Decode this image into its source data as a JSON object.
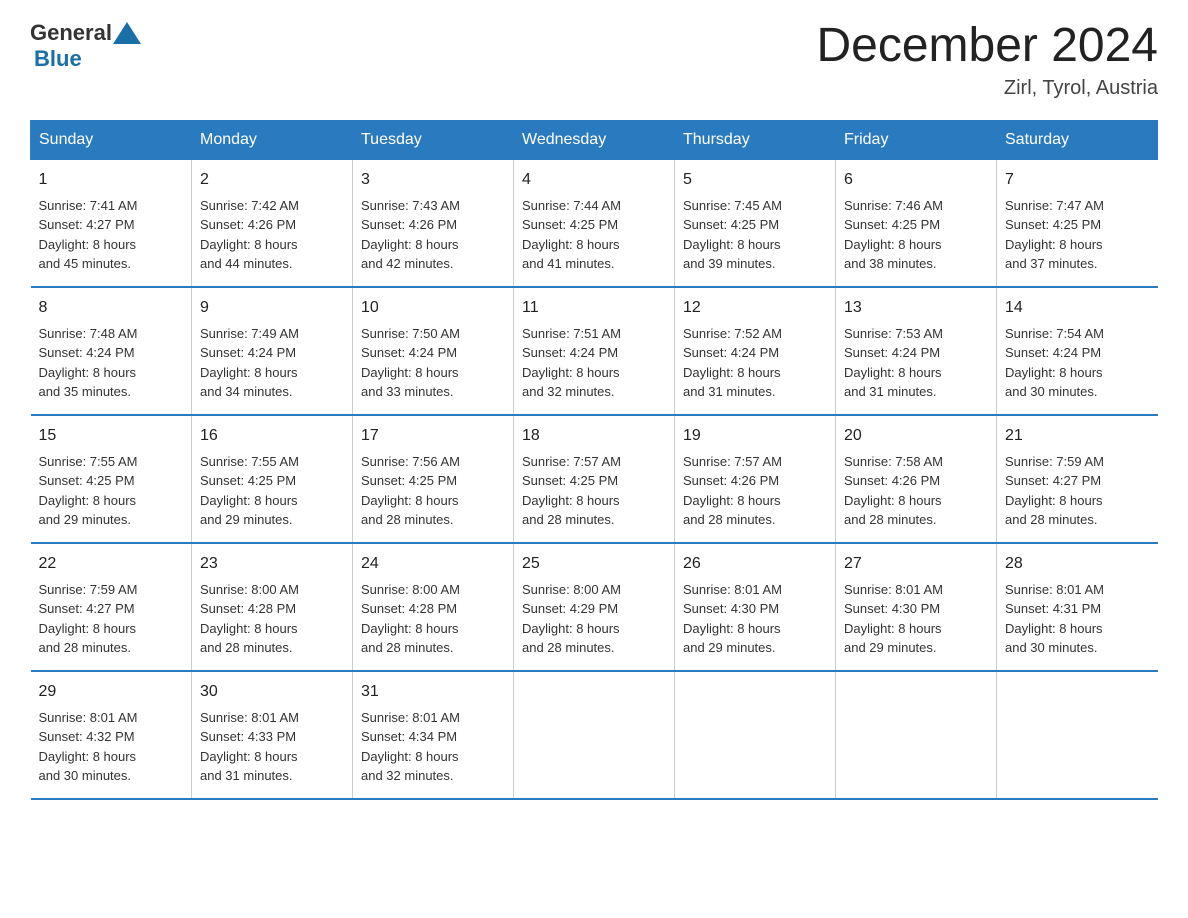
{
  "logo": {
    "general": "General",
    "blue": "Blue"
  },
  "header": {
    "month": "December 2024",
    "location": "Zirl, Tyrol, Austria"
  },
  "weekdays": [
    "Sunday",
    "Monday",
    "Tuesday",
    "Wednesday",
    "Thursday",
    "Friday",
    "Saturday"
  ],
  "weeks": [
    [
      {
        "day": "1",
        "sunrise": "7:41 AM",
        "sunset": "4:27 PM",
        "daylight": "8 hours and 45 minutes."
      },
      {
        "day": "2",
        "sunrise": "7:42 AM",
        "sunset": "4:26 PM",
        "daylight": "8 hours and 44 minutes."
      },
      {
        "day": "3",
        "sunrise": "7:43 AM",
        "sunset": "4:26 PM",
        "daylight": "8 hours and 42 minutes."
      },
      {
        "day": "4",
        "sunrise": "7:44 AM",
        "sunset": "4:25 PM",
        "daylight": "8 hours and 41 minutes."
      },
      {
        "day": "5",
        "sunrise": "7:45 AM",
        "sunset": "4:25 PM",
        "daylight": "8 hours and 39 minutes."
      },
      {
        "day": "6",
        "sunrise": "7:46 AM",
        "sunset": "4:25 PM",
        "daylight": "8 hours and 38 minutes."
      },
      {
        "day": "7",
        "sunrise": "7:47 AM",
        "sunset": "4:25 PM",
        "daylight": "8 hours and 37 minutes."
      }
    ],
    [
      {
        "day": "8",
        "sunrise": "7:48 AM",
        "sunset": "4:24 PM",
        "daylight": "8 hours and 35 minutes."
      },
      {
        "day": "9",
        "sunrise": "7:49 AM",
        "sunset": "4:24 PM",
        "daylight": "8 hours and 34 minutes."
      },
      {
        "day": "10",
        "sunrise": "7:50 AM",
        "sunset": "4:24 PM",
        "daylight": "8 hours and 33 minutes."
      },
      {
        "day": "11",
        "sunrise": "7:51 AM",
        "sunset": "4:24 PM",
        "daylight": "8 hours and 32 minutes."
      },
      {
        "day": "12",
        "sunrise": "7:52 AM",
        "sunset": "4:24 PM",
        "daylight": "8 hours and 31 minutes."
      },
      {
        "day": "13",
        "sunrise": "7:53 AM",
        "sunset": "4:24 PM",
        "daylight": "8 hours and 31 minutes."
      },
      {
        "day": "14",
        "sunrise": "7:54 AM",
        "sunset": "4:24 PM",
        "daylight": "8 hours and 30 minutes."
      }
    ],
    [
      {
        "day": "15",
        "sunrise": "7:55 AM",
        "sunset": "4:25 PM",
        "daylight": "8 hours and 29 minutes."
      },
      {
        "day": "16",
        "sunrise": "7:55 AM",
        "sunset": "4:25 PM",
        "daylight": "8 hours and 29 minutes."
      },
      {
        "day": "17",
        "sunrise": "7:56 AM",
        "sunset": "4:25 PM",
        "daylight": "8 hours and 28 minutes."
      },
      {
        "day": "18",
        "sunrise": "7:57 AM",
        "sunset": "4:25 PM",
        "daylight": "8 hours and 28 minutes."
      },
      {
        "day": "19",
        "sunrise": "7:57 AM",
        "sunset": "4:26 PM",
        "daylight": "8 hours and 28 minutes."
      },
      {
        "day": "20",
        "sunrise": "7:58 AM",
        "sunset": "4:26 PM",
        "daylight": "8 hours and 28 minutes."
      },
      {
        "day": "21",
        "sunrise": "7:59 AM",
        "sunset": "4:27 PM",
        "daylight": "8 hours and 28 minutes."
      }
    ],
    [
      {
        "day": "22",
        "sunrise": "7:59 AM",
        "sunset": "4:27 PM",
        "daylight": "8 hours and 28 minutes."
      },
      {
        "day": "23",
        "sunrise": "8:00 AM",
        "sunset": "4:28 PM",
        "daylight": "8 hours and 28 minutes."
      },
      {
        "day": "24",
        "sunrise": "8:00 AM",
        "sunset": "4:28 PM",
        "daylight": "8 hours and 28 minutes."
      },
      {
        "day": "25",
        "sunrise": "8:00 AM",
        "sunset": "4:29 PM",
        "daylight": "8 hours and 28 minutes."
      },
      {
        "day": "26",
        "sunrise": "8:01 AM",
        "sunset": "4:30 PM",
        "daylight": "8 hours and 29 minutes."
      },
      {
        "day": "27",
        "sunrise": "8:01 AM",
        "sunset": "4:30 PM",
        "daylight": "8 hours and 29 minutes."
      },
      {
        "day": "28",
        "sunrise": "8:01 AM",
        "sunset": "4:31 PM",
        "daylight": "8 hours and 30 minutes."
      }
    ],
    [
      {
        "day": "29",
        "sunrise": "8:01 AM",
        "sunset": "4:32 PM",
        "daylight": "8 hours and 30 minutes."
      },
      {
        "day": "30",
        "sunrise": "8:01 AM",
        "sunset": "4:33 PM",
        "daylight": "8 hours and 31 minutes."
      },
      {
        "day": "31",
        "sunrise": "8:01 AM",
        "sunset": "4:34 PM",
        "daylight": "8 hours and 32 minutes."
      },
      null,
      null,
      null,
      null
    ]
  ],
  "labels": {
    "sunrise": "Sunrise:",
    "sunset": "Sunset:",
    "daylight": "Daylight:"
  }
}
